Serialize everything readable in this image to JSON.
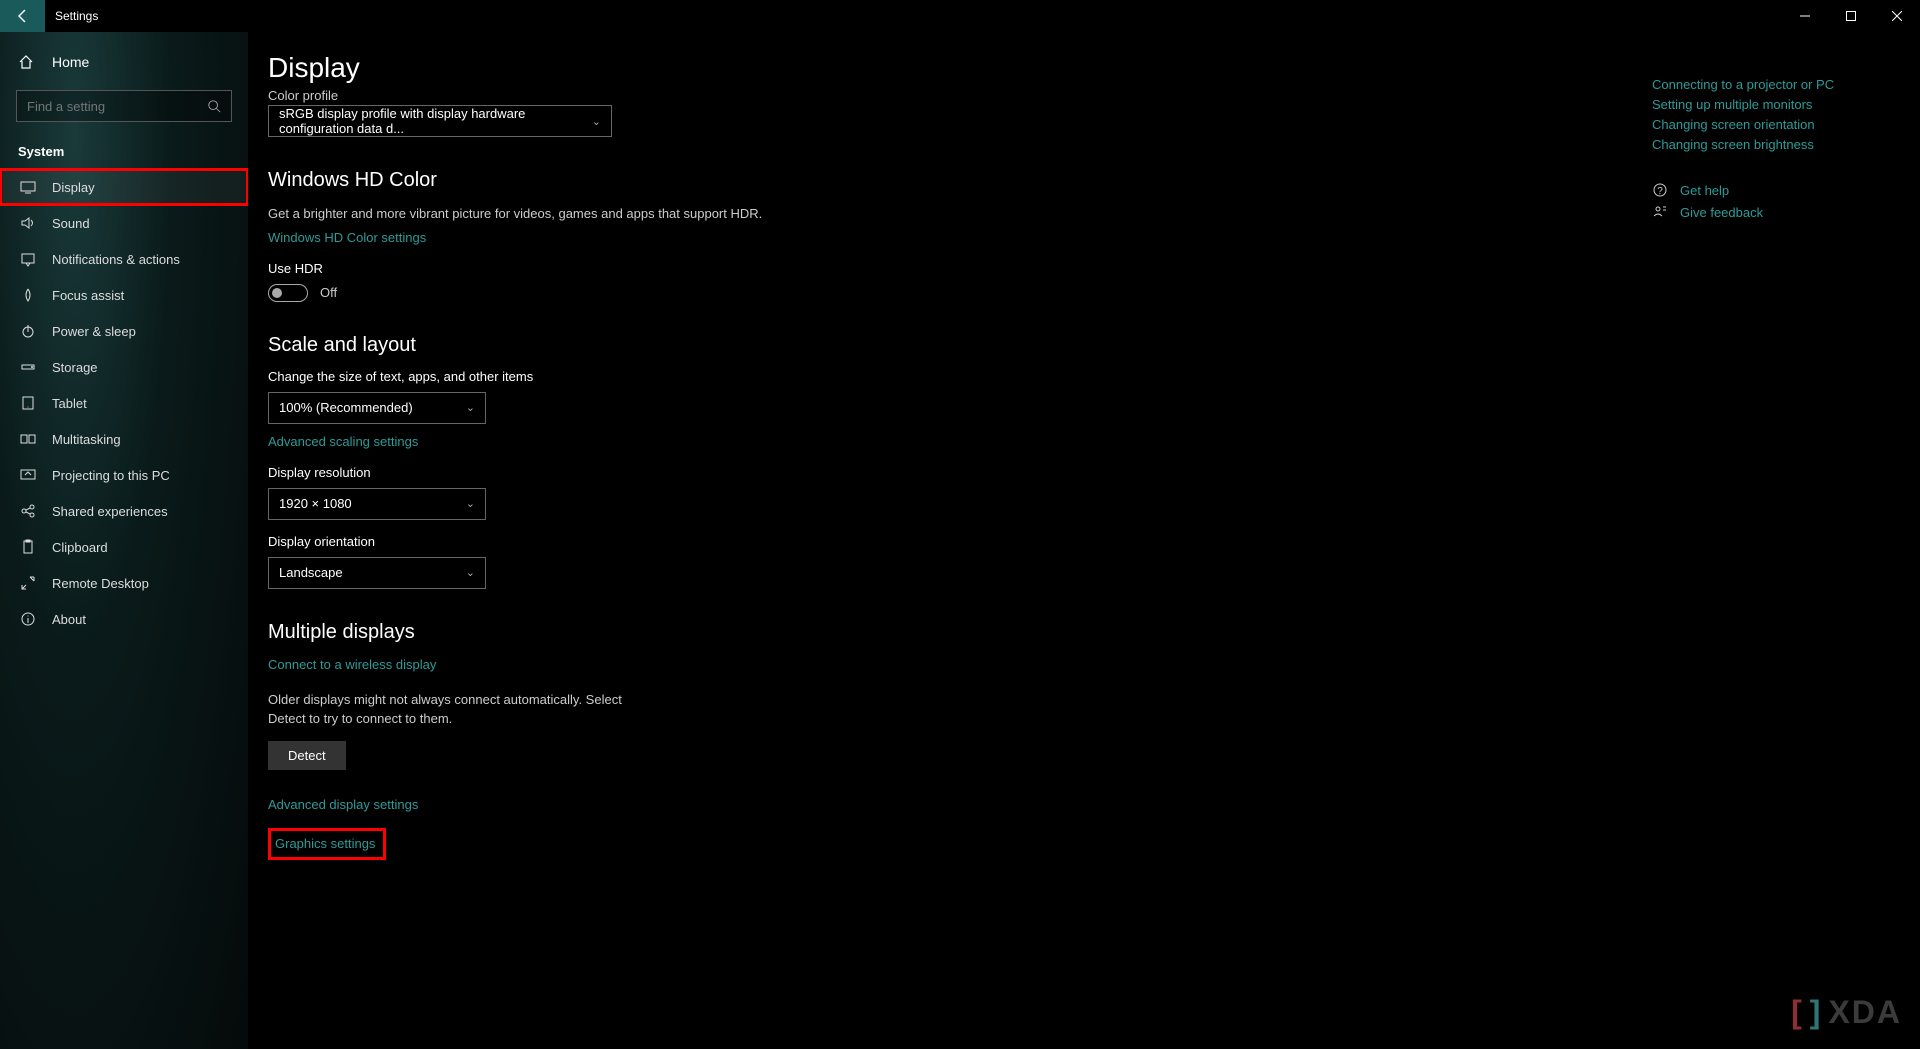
{
  "title": "Settings",
  "home_label": "Home",
  "search_placeholder": "Find a setting",
  "group_label": "System",
  "nav": [
    {
      "label": "Display",
      "icon": "display"
    },
    {
      "label": "Sound",
      "icon": "sound"
    },
    {
      "label": "Notifications & actions",
      "icon": "notify"
    },
    {
      "label": "Focus assist",
      "icon": "focus"
    },
    {
      "label": "Power & sleep",
      "icon": "power"
    },
    {
      "label": "Storage",
      "icon": "storage"
    },
    {
      "label": "Tablet",
      "icon": "tablet"
    },
    {
      "label": "Multitasking",
      "icon": "multi"
    },
    {
      "label": "Projecting to this PC",
      "icon": "project"
    },
    {
      "label": "Shared experiences",
      "icon": "shared"
    },
    {
      "label": "Clipboard",
      "icon": "clipboard"
    },
    {
      "label": "Remote Desktop",
      "icon": "remote"
    },
    {
      "label": "About",
      "icon": "about"
    }
  ],
  "page_heading": "Display",
  "color_profile": {
    "label_cut": "Color profile",
    "value": "sRGB display profile with display hardware configuration data d..."
  },
  "hd_color": {
    "heading": "Windows HD Color",
    "desc": "Get a brighter and more vibrant picture for videos, games and apps that support HDR.",
    "link": "Windows HD Color settings",
    "use_hdr_label": "Use HDR",
    "toggle_state": "Off"
  },
  "scale": {
    "heading": "Scale and layout",
    "text_size_label": "Change the size of text, apps, and other items",
    "text_size_value": "100% (Recommended)",
    "advanced_link": "Advanced scaling settings",
    "resolution_label": "Display resolution",
    "resolution_value": "1920 × 1080",
    "orientation_label": "Display orientation",
    "orientation_value": "Landscape"
  },
  "multiple": {
    "heading": "Multiple displays",
    "wireless_link": "Connect to a wireless display",
    "desc": "Older displays might not always connect automatically. Select Detect to try to connect to them.",
    "detect_btn": "Detect",
    "adv_link": "Advanced display settings",
    "graphics_link": "Graphics settings"
  },
  "right": {
    "links": [
      "Connecting to a projector or PC",
      "Setting up multiple monitors",
      "Changing screen orientation",
      "Changing screen brightness"
    ],
    "get_help": "Get help",
    "give_feedback": "Give feedback"
  },
  "watermark": "XDA"
}
